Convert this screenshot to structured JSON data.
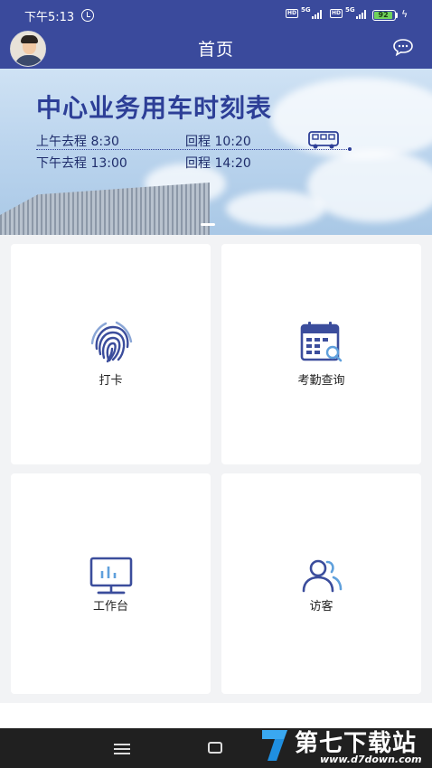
{
  "status_bar": {
    "time": "下午5:13",
    "hd": "HD",
    "network": "5G",
    "battery": "92",
    "battery_level": 0.92
  },
  "header": {
    "title": "首页"
  },
  "banner": {
    "title": "中心业务用车时刻表",
    "morning_out": "上午去程 8:30",
    "morning_return": "回程 10:20",
    "afternoon_out": "下午去程 13:00",
    "afternoon_return": "回程 14:20"
  },
  "tiles": [
    {
      "label": "打卡",
      "icon": "fingerprint-icon"
    },
    {
      "label": "考勤查询",
      "icon": "calendar-search-icon"
    },
    {
      "label": "工作台",
      "icon": "monitor-icon"
    },
    {
      "label": "访客",
      "icon": "visitors-icon"
    }
  ],
  "watermark": {
    "brand": "第七下载站",
    "url": "www.d7down.com"
  },
  "colors": {
    "primary": "#3a4a9c",
    "banner_text": "#2d3f97",
    "icon_blue": "#3b4d9c"
  }
}
